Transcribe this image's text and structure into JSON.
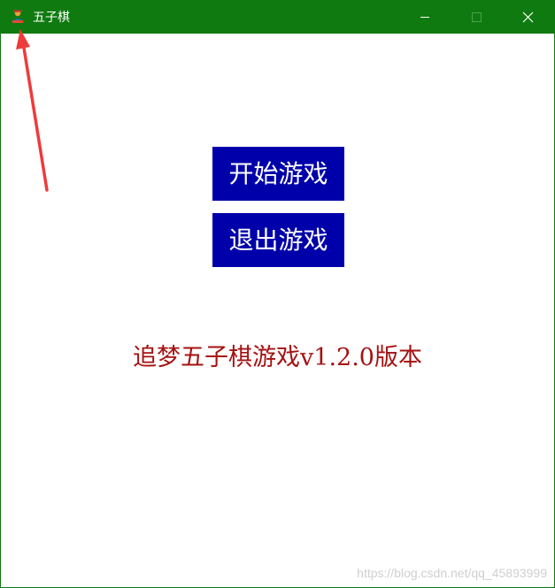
{
  "window": {
    "title": "五子棋",
    "icon": "app-icon",
    "controls": {
      "minimize_icon": "minimize-icon",
      "maximize_icon": "maximize-icon",
      "close_icon": "close-icon"
    },
    "colors": {
      "titlebar": "#0f7a10",
      "title_text": "#ffffff"
    }
  },
  "main": {
    "start_button_label": "开始游戏",
    "exit_button_label": "退出游戏",
    "version_label": "追梦五子棋游戏v1.2.0版本",
    "colors": {
      "button_bg": "#0000aa",
      "button_text": "#ffffff",
      "version_text": "#a51212"
    }
  },
  "annotation": {
    "arrow_icon": "red-arrow-icon",
    "color": "#ee3b3b"
  },
  "watermark": "https://blog.csdn.net/qq_45893999"
}
